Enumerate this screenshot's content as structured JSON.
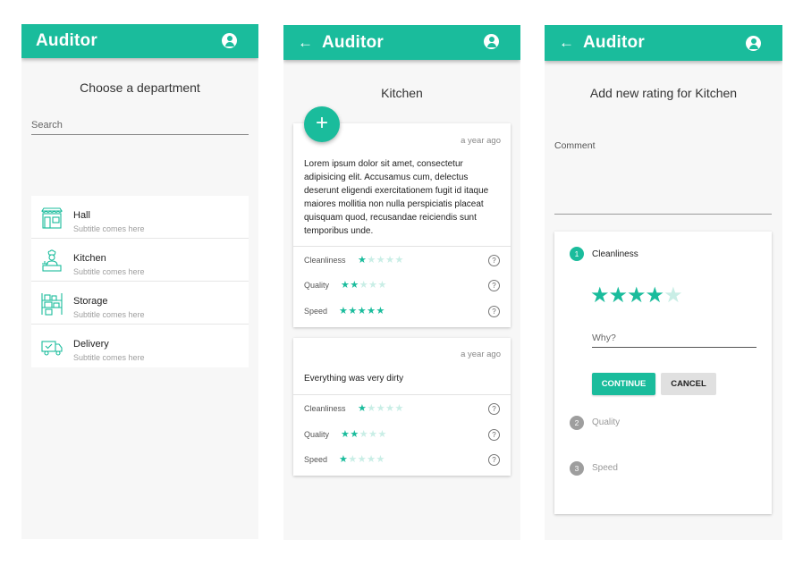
{
  "app": {
    "title": "Auditor"
  },
  "screen1": {
    "heading": "Choose a department",
    "search": {
      "placeholder": "Search"
    },
    "departments": [
      {
        "title": "Hall",
        "subtitle": "Subtitle comes here",
        "icon": "storefront-icon"
      },
      {
        "title": "Kitchen",
        "subtitle": "Subtitle comes here",
        "icon": "chef-icon"
      },
      {
        "title": "Storage",
        "subtitle": "Subtitle comes here",
        "icon": "shelves-icon"
      },
      {
        "title": "Delivery",
        "subtitle": "Subtitle comes here",
        "icon": "delivery-truck-icon"
      }
    ]
  },
  "screen2": {
    "heading": "Kitchen",
    "fab": "+",
    "reviews": [
      {
        "time": "a year ago",
        "text": "Lorem ipsum dolor sit amet, consectetur adipisicing elit. Accusamus cum, delectus deserunt eligendi exercitationem fugit id itaque maiores mollitia non nulla perspiciatis placeat quisquam quod, recusandae reiciendis sunt temporibus unde.",
        "ratings": [
          {
            "label": "Cleanliness",
            "stars": 1
          },
          {
            "label": "Quality",
            "stars": 2
          },
          {
            "label": "Speed",
            "stars": 5
          }
        ]
      },
      {
        "time": "a year ago",
        "text": "Everything was very dirty",
        "ratings": [
          {
            "label": "Cleanliness",
            "stars": 1
          },
          {
            "label": "Quality",
            "stars": 2
          },
          {
            "label": "Speed",
            "stars": 1
          }
        ]
      }
    ],
    "max_stars": 5
  },
  "screen3": {
    "heading": "Add new rating for Kitchen",
    "comment_label": "Comment",
    "steps": [
      {
        "num": "1",
        "label": "Cleanliness",
        "active": true
      },
      {
        "num": "2",
        "label": "Quality",
        "active": false
      },
      {
        "num": "3",
        "label": "Speed",
        "active": false
      }
    ],
    "current_stars": 4,
    "max_stars": 5,
    "why_placeholder": "Why?",
    "continue_label": "CONTINUE",
    "cancel_label": "CANCEL"
  },
  "colors": {
    "accent": "#1abc9c",
    "star_off": "#c9eee6",
    "step_inactive": "#9e9e9e"
  }
}
